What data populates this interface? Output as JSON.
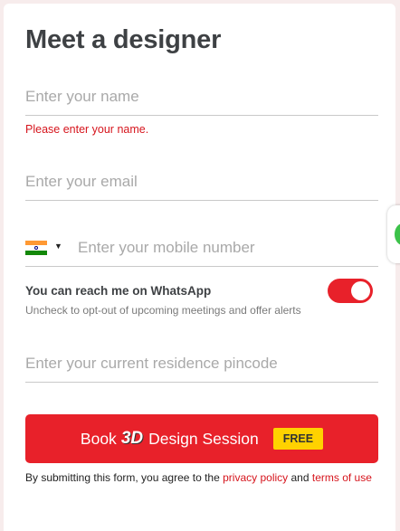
{
  "form": {
    "title": "Meet a designer",
    "name": {
      "placeholder": "Enter your name",
      "value": "",
      "error": "Please enter your name."
    },
    "email": {
      "placeholder": "Enter your email",
      "value": ""
    },
    "mobile": {
      "country_flag": "india-flag-icon",
      "placeholder": "Enter your mobile number",
      "value": ""
    },
    "whatsapp": {
      "label": "You can reach me on WhatsApp",
      "sublabel": "Uncheck to opt-out of upcoming meetings and offer alerts",
      "enabled": true
    },
    "pincode": {
      "placeholder": "Enter your current residence pincode",
      "value": ""
    },
    "submit": {
      "prefix": "Book",
      "highlight": "3D",
      "suffix": "Design Session",
      "badge": "FREE"
    },
    "consent": {
      "text_prefix": "By submitting this form, you agree to the",
      "privacy_link": "privacy policy",
      "and": "and",
      "terms_link": "terms of use"
    }
  },
  "colors": {
    "accent": "#e8212a",
    "badge": "#ffd200",
    "error": "#d6151d",
    "chat_widget": "#3cc24a"
  },
  "side_widget": {
    "icon": "chat-icon"
  }
}
